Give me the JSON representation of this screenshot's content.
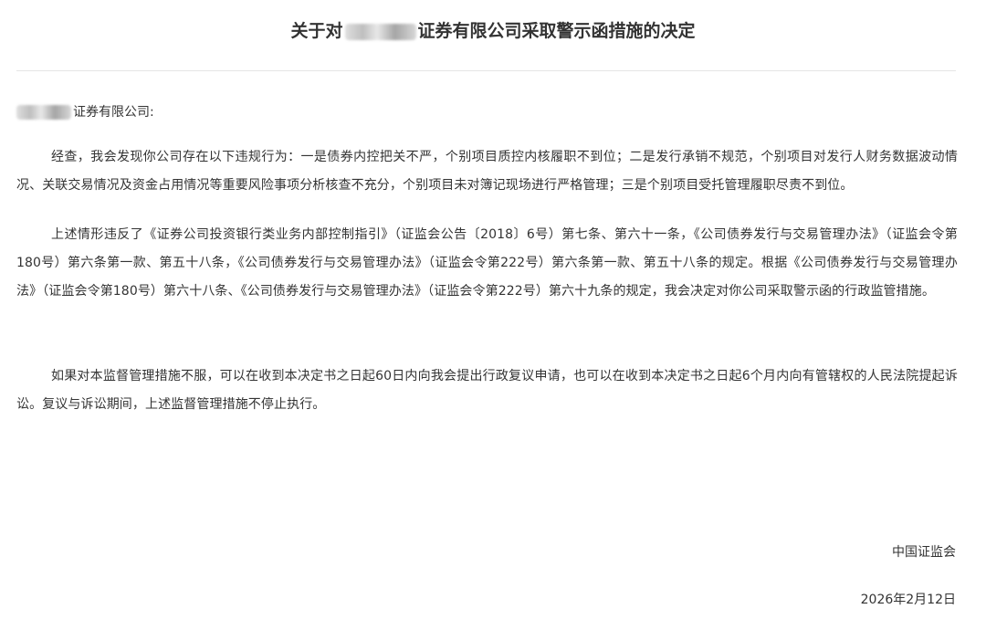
{
  "document": {
    "title_prefix": "关于对",
    "title_suffix": "证券有限公司采取警示函措施的决定",
    "addressee_suffix": "证券有限公司:",
    "paragraphs": [
      "经查，我会发现你公司存在以下违规行为：一是债券内控把关不严，个别项目质控内核履职不到位；二是发行承销不规范，个别项目对发行人财务数据波动情况、关联交易情况及资金占用情况等重要风险事项分析核查不充分，个别项目未对簿记现场进行严格管理；三是个别项目受托管理履职尽责不到位。",
      "上述情形违反了《证券公司投资银行类业务内部控制指引》（证监会公告〔2018〕6号）第七条、第六十一条，《公司债券发行与交易管理办法》（证监会令第180号）第六条第一款、第五十八条，《公司债券发行与交易管理办法》（证监会令第222号）第六条第一款、第五十八条的规定。根据《公司债券发行与交易管理办法》（证监会令第180号）第六十八条、《公司债券发行与交易管理办法》（证监会令第222号）第六十九条的规定，我会决定对你公司采取警示函的行政监管措施。",
      "如果对本监督管理措施不服，可以在收到本决定书之日起60日内向我会提出行政复议申请，也可以在收到本决定书之日起6个月内向有管辖权的人民法院提起诉讼。复议与诉讼期间，上述监督管理措施不停止执行。"
    ],
    "signature": "中国证监会",
    "date": "2026年2月12日"
  },
  "colors": {
    "text": "#333333",
    "divider": "#e5e5e5",
    "background": "#ffffff"
  }
}
